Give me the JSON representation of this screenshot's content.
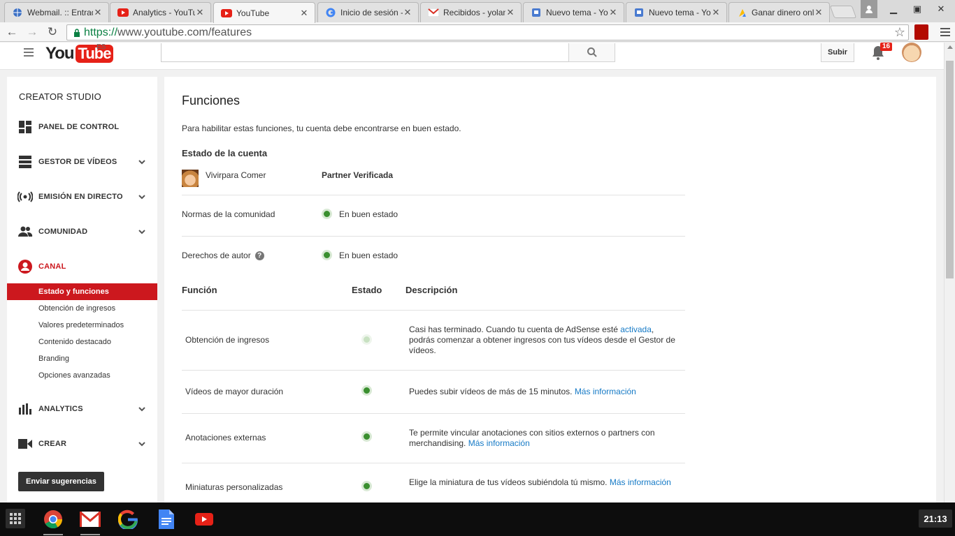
{
  "browser": {
    "tabs": [
      {
        "title": "Webmail. :: Entrad",
        "icon": "globe-icon",
        "active": false
      },
      {
        "title": "Analytics - YouTul",
        "icon": "youtube-icon",
        "active": false
      },
      {
        "title": "YouTube",
        "icon": "youtube-icon",
        "active": true
      },
      {
        "title": "Inicio de sesión -",
        "icon": "google-icon",
        "active": false
      },
      {
        "title": "Recibidos - yolan",
        "icon": "gmail-icon",
        "active": false
      },
      {
        "title": "Nuevo tema - You",
        "icon": "forum-icon",
        "active": false
      },
      {
        "title": "Nuevo tema - You",
        "icon": "forum-icon",
        "active": false
      },
      {
        "title": "Ganar dinero onli",
        "icon": "adsense-icon",
        "active": false
      }
    ],
    "url_scheme": "https://",
    "url_rest": "www.youtube.com/features"
  },
  "masthead": {
    "logo_you": "You",
    "logo_tube": "Tube",
    "country": "ES",
    "upload_label": "Subir",
    "notification_count": "16"
  },
  "sidebar": {
    "title": "CREATOR STUDIO",
    "sections": [
      {
        "label": "PANEL DE CONTROL",
        "icon": "dashboard-icon"
      },
      {
        "label": "GESTOR DE VÍDEOS",
        "icon": "video-manager-icon"
      },
      {
        "label": "EMISIÓN EN DIRECTO",
        "icon": "live-icon"
      },
      {
        "label": "COMUNIDAD",
        "icon": "community-icon"
      },
      {
        "label": "CANAL",
        "icon": "channel-icon"
      }
    ],
    "channel_items": [
      "Estado y funciones",
      "Obtención de ingresos",
      "Valores predeterminados",
      "Contenido destacado",
      "Branding",
      "Opciones avanzadas"
    ],
    "bottom_sections": [
      {
        "label": "ANALYTICS",
        "icon": "analytics-icon"
      },
      {
        "label": "CREAR",
        "icon": "create-icon"
      }
    ],
    "feedback_label": "Enviar sugerencias"
  },
  "main": {
    "title": "Funciones",
    "description": "Para habilitar estas funciones, tu cuenta debe encontrarse en buen estado.",
    "account_heading": "Estado de la cuenta",
    "account_name": "Vivirpara Comer",
    "account_type": "Partner Verificada",
    "standing": [
      {
        "label": "Normas de la comunidad",
        "status": "En buen estado",
        "help": false
      },
      {
        "label": "Derechos de autor",
        "status": "En buen estado",
        "help": true
      }
    ],
    "table_headers": [
      "Función",
      "Estado",
      "Descripción"
    ],
    "features": [
      {
        "name": "Obtención de ingresos",
        "status": "pending",
        "desc": "Casi has terminado. Cuando tu cuenta de AdSense esté ",
        "link": "activada",
        "desc_after": ", podrás comenzar a obtener ingresos con tus vídeos desde el Gestor de vídeos."
      },
      {
        "name": "Vídeos de mayor duración",
        "status": "enabled",
        "desc": "Puedes subir vídeos de más de 15 minutos. ",
        "link": "Más información",
        "desc_after": ""
      },
      {
        "name": "Anotaciones externas",
        "status": "enabled",
        "desc": "Te permite vincular anotaciones con sitios externos o partners con merchandising. ",
        "link": "Más información",
        "desc_after": ""
      },
      {
        "name": "Miniaturas personalizadas",
        "status": "enabled",
        "desc": "Elige la miniatura de tus vídeos subiéndola tú mismo. ",
        "link": "Más información",
        "desc_after": ""
      }
    ]
  },
  "taskbar": {
    "apps": [
      "chrome-icon",
      "gmail-icon",
      "google-icon",
      "docs-icon",
      "youtube-icon"
    ],
    "clock": "21:13"
  },
  "colors": {
    "accent_red": "#cc181e",
    "link_blue": "#167ac6",
    "status_green": "#3a8f2f"
  }
}
